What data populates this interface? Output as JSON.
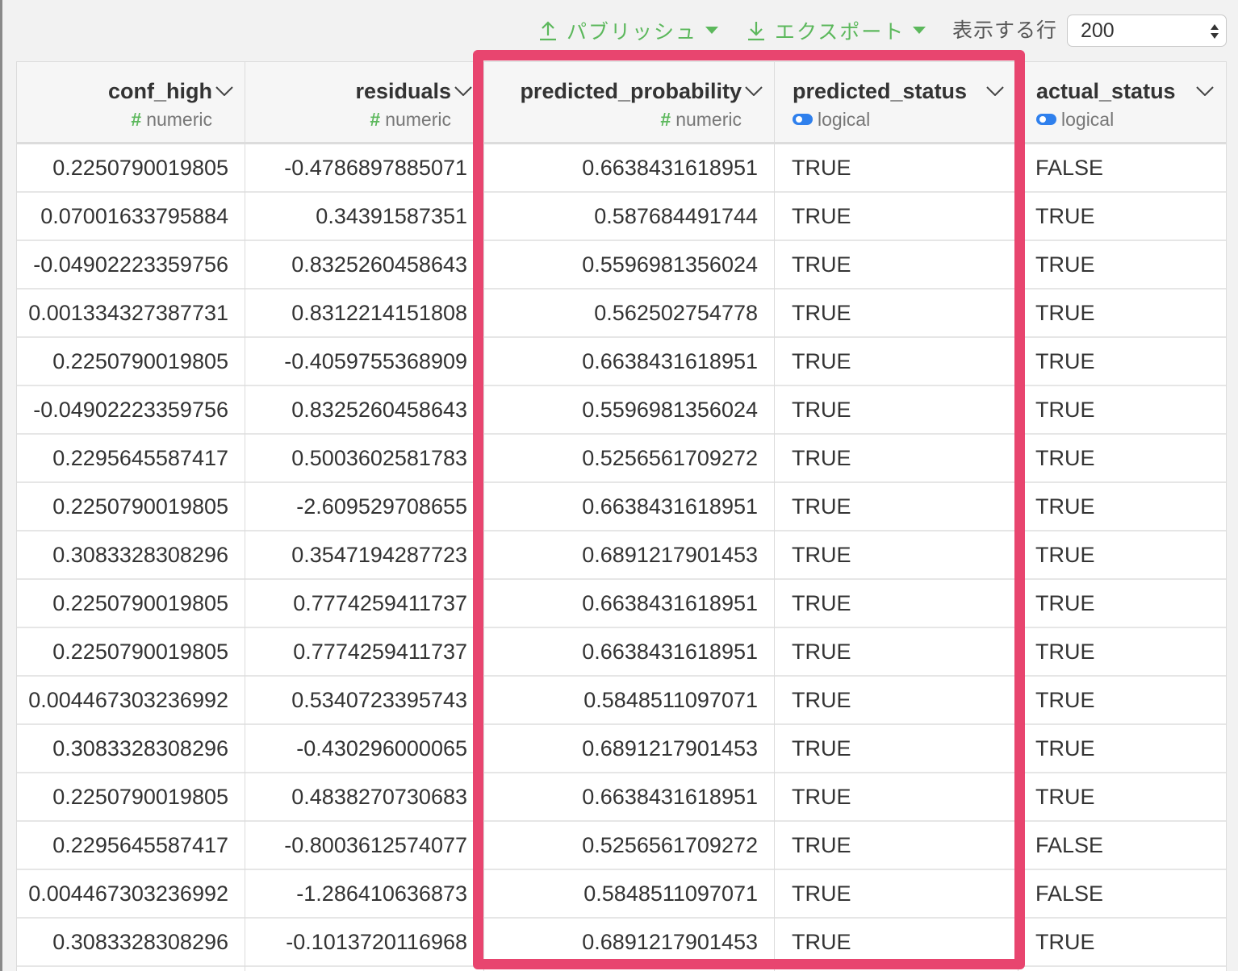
{
  "toolbar": {
    "publish_label": "パブリッシュ",
    "export_label": "エクスポート",
    "rows_label": "表示する行",
    "rows_value": "200",
    "accent_color": "#5cb85c"
  },
  "highlight_color": "#e8456f",
  "columns": [
    {
      "name": "conf_high",
      "type": "numeric"
    },
    {
      "name": "residuals",
      "type": "numeric"
    },
    {
      "name": "predicted_probability",
      "type": "numeric"
    },
    {
      "name": "predicted_status",
      "type": "logical"
    },
    {
      "name": "actual_status",
      "type": "logical"
    }
  ],
  "rows": [
    [
      "0.2250790019805",
      "-0.4786897885071",
      "0.6638431618951",
      "TRUE",
      "FALSE"
    ],
    [
      "0.07001633795884",
      "0.34391587351",
      "0.587684491744",
      "TRUE",
      "TRUE"
    ],
    [
      "-0.04902223359756",
      "0.8325260458643",
      "0.5596981356024",
      "TRUE",
      "TRUE"
    ],
    [
      "0.001334327387731",
      "0.8312214151808",
      "0.562502754778",
      "TRUE",
      "TRUE"
    ],
    [
      "0.2250790019805",
      "-0.4059755368909",
      "0.6638431618951",
      "TRUE",
      "TRUE"
    ],
    [
      "-0.04902223359756",
      "0.8325260458643",
      "0.5596981356024",
      "TRUE",
      "TRUE"
    ],
    [
      "0.2295645587417",
      "0.5003602581783",
      "0.5256561709272",
      "TRUE",
      "TRUE"
    ],
    [
      "0.2250790019805",
      "-2.609529708655",
      "0.6638431618951",
      "TRUE",
      "TRUE"
    ],
    [
      "0.3083328308296",
      "0.3547194287723",
      "0.6891217901453",
      "TRUE",
      "TRUE"
    ],
    [
      "0.2250790019805",
      "0.7774259411737",
      "0.6638431618951",
      "TRUE",
      "TRUE"
    ],
    [
      "0.2250790019805",
      "0.7774259411737",
      "0.6638431618951",
      "TRUE",
      "TRUE"
    ],
    [
      "0.004467303236992",
      "0.5340723395743",
      "0.5848511097071",
      "TRUE",
      "TRUE"
    ],
    [
      "0.3083328308296",
      "-0.430296000065",
      "0.6891217901453",
      "TRUE",
      "TRUE"
    ],
    [
      "0.2250790019805",
      "0.4838270730683",
      "0.6638431618951",
      "TRUE",
      "TRUE"
    ],
    [
      "0.2295645587417",
      "-0.8003612574077",
      "0.5256561709272",
      "TRUE",
      "FALSE"
    ],
    [
      "0.004467303236992",
      "-1.286410636873",
      "0.5848511097071",
      "TRUE",
      "FALSE"
    ],
    [
      "0.3083328308296",
      "-0.1013720116968",
      "0.6891217901453",
      "TRUE",
      "TRUE"
    ]
  ]
}
